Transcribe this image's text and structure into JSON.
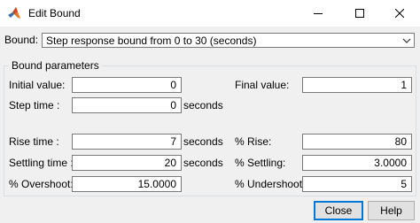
{
  "window": {
    "title": "Edit Bound",
    "icon": "matlab-logo-icon"
  },
  "bound": {
    "label": "Bound:",
    "selected": "Step response bound from 0 to 30 (seconds)"
  },
  "group": {
    "title": "Bound parameters"
  },
  "params": {
    "initial_value": {
      "label": "Initial value:",
      "value": "0"
    },
    "final_value": {
      "label": "Final value:",
      "value": "1"
    },
    "step_time": {
      "label": "Step time :",
      "value": "0",
      "unit": "seconds"
    },
    "rise_time": {
      "label": "Rise time :",
      "value": "7",
      "unit": "seconds"
    },
    "pct_rise": {
      "label": "% Rise:",
      "value": "80"
    },
    "settling_time": {
      "label": "Settling time :",
      "value": "20",
      "unit": "seconds"
    },
    "pct_settling": {
      "label": "% Settling:",
      "value": "3.0000"
    },
    "pct_overshoot": {
      "label": "% Overshoot:",
      "value": "15.0000"
    },
    "pct_undershoot": {
      "label": "% Undershoot:",
      "value": "5"
    }
  },
  "buttons": {
    "close": "Close",
    "help": "Help"
  },
  "colors": {
    "accent": "#0078d7",
    "background": "#f0f0f0"
  }
}
